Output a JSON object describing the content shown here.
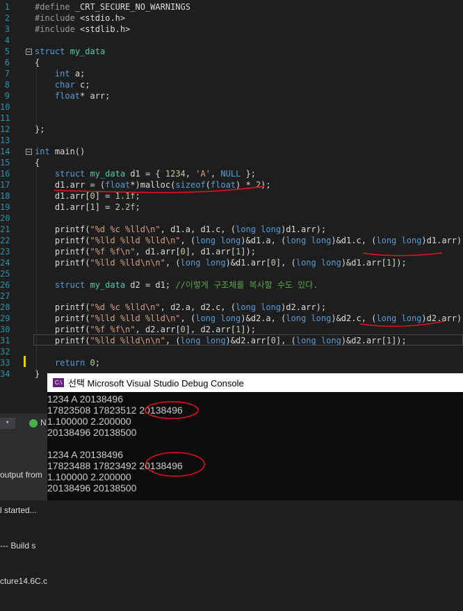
{
  "editor": {
    "line_numbers": [
      "1",
      "2",
      "3",
      "4",
      "5",
      "6",
      "7",
      "8",
      "9",
      "10",
      "11",
      "12",
      "13",
      "14",
      "15",
      "16",
      "17",
      "18",
      "19",
      "20",
      "21",
      "22",
      "23",
      "24",
      "25",
      "26",
      "27",
      "28",
      "29",
      "30",
      "31",
      "32",
      "33",
      "34"
    ],
    "lines": [
      "#define _CRT_SECURE_NO_WARNINGS",
      "#include <stdio.h>",
      "#include <stdlib.h>",
      "",
      "struct my_data",
      "{",
      "    int a;",
      "    char c;",
      "    float* arr;",
      "",
      "",
      "};",
      "",
      "int main()",
      "{",
      "    struct my_data d1 = { 1234, 'A', NULL };",
      "    d1.arr = (float*)malloc(sizeof(float) * 2);",
      "    d1.arr[0] = 1.1f;",
      "    d1.arr[1] = 2.2f;",
      "",
      "    printf(\"%d %c %lld\\n\", d1.a, d1.c, (long long)d1.arr);",
      "    printf(\"%lld %lld %lld\\n\", (long long)&d1.a, (long long)&d1.c, (long long)d1.arr);",
      "    printf(\"%f %f\\n\", d1.arr[0], d1.arr[1]);",
      "    printf(\"%lld %lld\\n\\n\", (long long)&d1.arr[0], (long long)&d1.arr[1]);",
      "",
      "    struct my_data d2 = d1; //이렇게 구조체를 복사할 수도 있다.",
      "",
      "    printf(\"%d %c %lld\\n\", d2.a, d2.c, (long long)d2.arr);",
      "    printf(\"%lld %lld %lld\\n\", (long long)&d2.a, (long long)&d2.c, (long long)d2.arr);",
      "    printf(\"%f %f\\n\", d2.arr[0], d2.arr[1]);",
      "    printf(\"%lld %lld\\n\\n\", (long long)&d2.arr[0], (long long)&d2.arr[1]);",
      "",
      "    return 0;",
      "}"
    ]
  },
  "console": {
    "icon": "C:\\",
    "title": "선택 Microsoft Visual Studio Debug Console",
    "lines": [
      "1234 A 20138496",
      "17823508 17823512 20138496",
      "1.100000 2.200000",
      "20138496 20138500",
      "",
      "1234 A 20138496",
      "17823488 17823492 20138496",
      "1.100000 2.200000",
      "20138496 20138500"
    ]
  },
  "left_panel": {
    "item1": "N",
    "lines": [
      "output from",
      "l started...",
      "--- Build s",
      "cture14.6C.c"
    ]
  },
  "colors": {
    "keyword": "#569cd6",
    "preprocessor": "#9b9b9b",
    "string": "#d69d85",
    "number": "#b5cea8",
    "comment": "#57a64a",
    "type_name": "#4ec9b0",
    "line_number": "#2b91af",
    "annotation": "#e81123"
  }
}
